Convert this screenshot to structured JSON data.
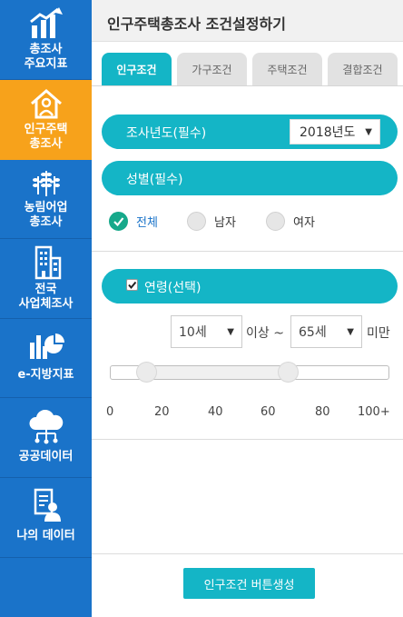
{
  "sidebar": {
    "items": [
      {
        "label": "총조사\n주요지표",
        "icon": "bar-chart-up-icon",
        "active": false
      },
      {
        "label": "인구주택\n총조사",
        "icon": "house-person-icon",
        "active": true
      },
      {
        "label": "농림어업\n총조사",
        "icon": "wheat-icon",
        "active": false
      },
      {
        "label": "전국\n사업체조사",
        "icon": "building-icon",
        "active": false
      },
      {
        "label": "e-지방지표",
        "icon": "bar-pie-chart-icon",
        "active": false
      },
      {
        "label": "공공데이터",
        "icon": "cloud-network-icon",
        "active": false
      },
      {
        "label": "나의 데이터",
        "icon": "document-person-icon",
        "active": false
      }
    ]
  },
  "header": {
    "title": "인구주택총조사 조건설정하기"
  },
  "tabs": [
    {
      "label": "인구조건",
      "active": true
    },
    {
      "label": "가구조건",
      "active": false
    },
    {
      "label": "주택조건",
      "active": false
    },
    {
      "label": "결합조건",
      "active": false
    }
  ],
  "survey_year": {
    "label": "조사년도(필수)",
    "value": "2018년도"
  },
  "gender": {
    "label": "성별(필수)",
    "options": [
      {
        "label": "전체",
        "selected": true
      },
      {
        "label": "남자",
        "selected": false
      },
      {
        "label": "여자",
        "selected": false
      }
    ]
  },
  "age": {
    "label": "연령(선택)",
    "checked": true,
    "from_value": "10세",
    "from_suffix": "이상 ~",
    "to_value": "65세",
    "to_suffix": "미만",
    "slider_min_fraction": 0.1,
    "slider_max_fraction": 0.65,
    "scale_labels": [
      "0",
      "20",
      "40",
      "60",
      "80",
      "100+"
    ]
  },
  "generate_button": {
    "label": "인구조건 버튼생성"
  },
  "colors": {
    "sidebar": "#1a73c9",
    "sidebar_active": "#f7a21b",
    "accent": "#14b5c6",
    "radio_checked": "#17a98b"
  }
}
